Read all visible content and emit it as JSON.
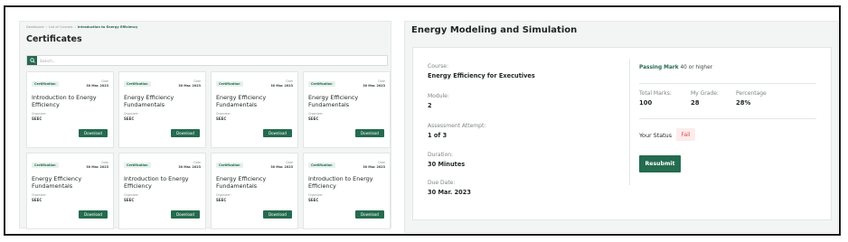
{
  "breadcrumb": [
    "Dashboard",
    "List of Courses",
    "Introduction to Energy Efficiency"
  ],
  "page_title": "Certificates",
  "search": {
    "placeholder": "Search..."
  },
  "certificates": [
    {
      "badge": "Certification",
      "date_label": "Date",
      "date": "30 Mar. 2023",
      "title": "Introduction to Energy Efficiency",
      "organizer_label": "Organizer:",
      "organizer": "SEEC",
      "button": "Download"
    },
    {
      "badge": "Certification",
      "date_label": "Date",
      "date": "30 Mar. 2023",
      "title": "Energy Efficiency Fundamentals",
      "organizer_label": "Organizer:",
      "organizer": "SEEC",
      "button": "Download"
    },
    {
      "badge": "Certification",
      "date_label": "Date",
      "date": "30 Mar. 2023",
      "title": "Energy Efficiency Fundamentals",
      "organizer_label": "Organizer:",
      "organizer": "SEEC",
      "button": "Download"
    },
    {
      "badge": "Certification",
      "date_label": "Date",
      "date": "30 Mar. 2023",
      "title": "Energy Efficiency Fundamentals",
      "organizer_label": "Organizer:",
      "organizer": "SEEC",
      "button": "Download"
    },
    {
      "badge": "Certification",
      "date_label": "Date",
      "date": "30 Mar. 2023",
      "title": "Energy Efficiency Fundamentals",
      "organizer_label": "Organizer:",
      "organizer": "SEEC",
      "button": "Download"
    },
    {
      "badge": "Certification",
      "date_label": "Date",
      "date": "30 Mar. 2023",
      "title": "Introduction to Energy Efficiency",
      "organizer_label": "Organizer:",
      "organizer": "SEEC",
      "button": "Download"
    },
    {
      "badge": "Certification",
      "date_label": "Date",
      "date": "30 Mar. 2023",
      "title": "Energy Efficiency Fundamentals",
      "organizer_label": "Organizer:",
      "organizer": "SEEC",
      "button": "Download"
    },
    {
      "badge": "Certification",
      "date_label": "Date",
      "date": "30 Mar. 2023",
      "title": "Introduction to Energy Efficiency",
      "organizer_label": "Organizer:",
      "organizer": "SEEC",
      "button": "Download"
    }
  ],
  "detail": {
    "title": "Energy Modeling and Simulation",
    "course_label": "Course:",
    "course": "Energy Efficiency for Executives",
    "module_label": "Module:",
    "module": "2",
    "attempt_label": "Assessment Attempt:",
    "attempt": "1 of 3",
    "duration_label": "Duration:",
    "duration": "30 Minutes",
    "due_label": "Due Date:",
    "due": "30 Mar. 2023",
    "passing_label": "Passing Mark",
    "passing_value": "40 or higher",
    "total_label": "Total Marks:",
    "total": "100",
    "grade_label": "My Grade:",
    "grade": "28",
    "percentage_label": "Percentage",
    "percentage": "28%",
    "status_label": "Your Status",
    "status": "Fail",
    "resubmit": "Resubmit"
  },
  "colors": {
    "accent": "#256b4f",
    "fail": "#e04848",
    "fail_bg": "#fdecec",
    "panel_bg": "#f3f4f4"
  },
  "icons": {
    "search_button": "search-icon"
  }
}
